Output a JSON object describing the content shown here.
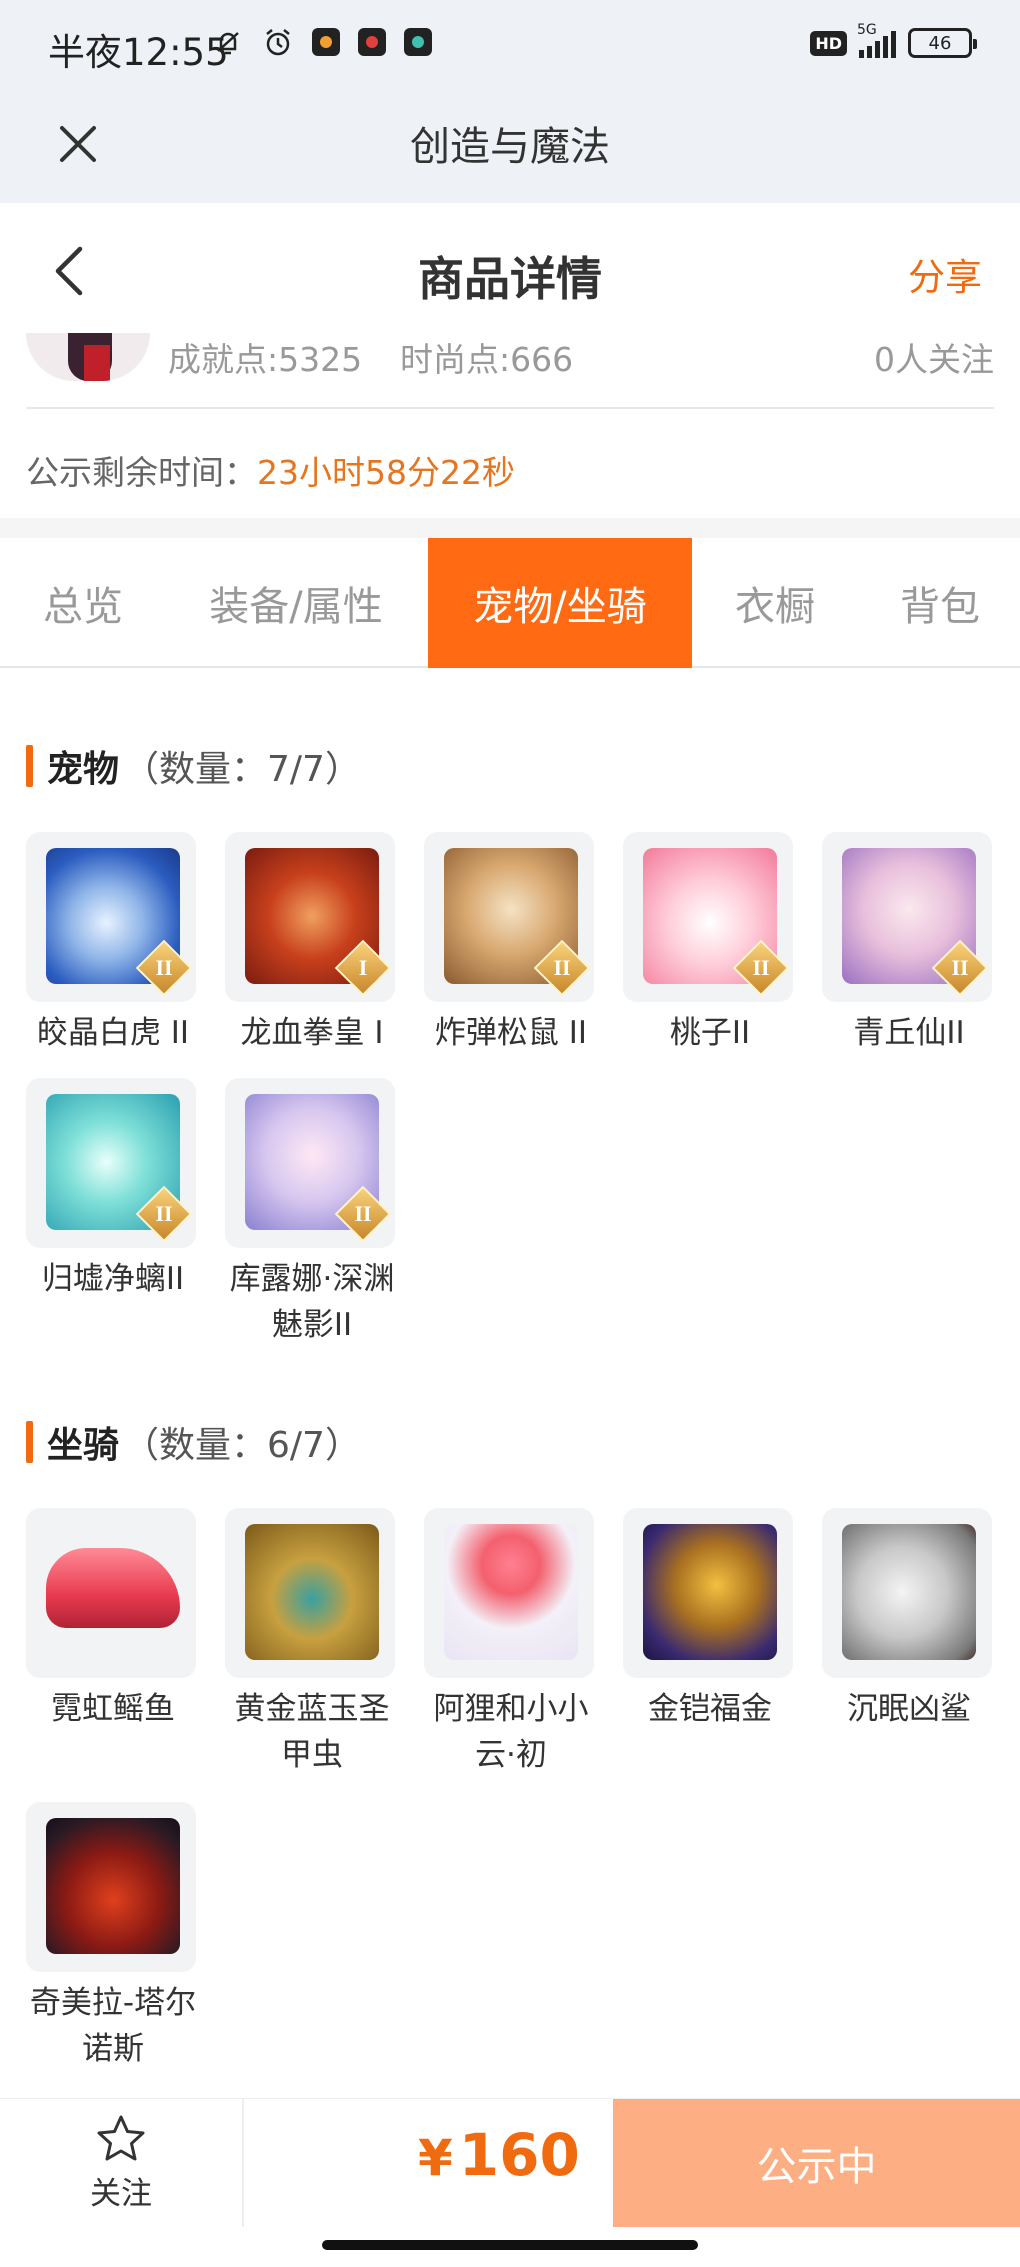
{
  "status_bar": {
    "time": "半夜12:55",
    "hd": "HD",
    "network": "5G",
    "battery": "46"
  },
  "app_header": {
    "title": "创造与魔法"
  },
  "page_nav": {
    "title": "商品详情",
    "share": "分享"
  },
  "user_info": {
    "achievement": "成就点:5325",
    "fashion": "时尚点:666",
    "followers": "0人关注"
  },
  "countdown": {
    "label": "公示剩余时间：",
    "value": "23小时58分22秒"
  },
  "tabs": [
    {
      "label": "总览"
    },
    {
      "label": "装备/属性"
    },
    {
      "label": "宠物/坐骑",
      "active": true
    },
    {
      "label": "衣橱"
    },
    {
      "label": "背包"
    }
  ],
  "pets": {
    "title": "宠物",
    "count": "（数量：7/7）",
    "items": [
      {
        "name": "皎晶白虎 II",
        "badge": "II",
        "icon": "white-tiger"
      },
      {
        "name": "龙血拳皇 I",
        "badge": "I",
        "icon": "dragon-boxer"
      },
      {
        "name": "炸弹松鼠 II",
        "badge": "II",
        "icon": "bomb-squirrel"
      },
      {
        "name": "桃子II",
        "badge": "II",
        "icon": "pink-fox"
      },
      {
        "name": "青丘仙II",
        "badge": "II",
        "icon": "fox-fairy"
      },
      {
        "name": "归墟净螭II",
        "badge": "II",
        "icon": "water-dragon"
      },
      {
        "name": "库露娜·深渊魅影II",
        "badge": "II",
        "icon": "abyss-phantom"
      }
    ]
  },
  "mounts": {
    "title": "坐骑",
    "count": "（数量：6/7）",
    "items": [
      {
        "name": "霓虹鳐鱼",
        "icon": "neon-ray"
      },
      {
        "name": "黄金蓝玉圣甲虫",
        "icon": "golden-scarab"
      },
      {
        "name": "阿狸和小小云·初",
        "icon": "ahri-cloud"
      },
      {
        "name": "金铠福金",
        "icon": "golden-armor"
      },
      {
        "name": "沉眠凶鲨",
        "icon": "shark"
      },
      {
        "name": "奇美拉-塔尔诺斯",
        "icon": "chimera"
      }
    ]
  },
  "bottom_bar": {
    "follow_label": "关注",
    "currency": "¥",
    "price": "160",
    "status": "公示中"
  },
  "colors": {
    "accent": "#ff6a13",
    "price": "#f06a10",
    "countdown": "#e5751e",
    "status_button": "#fdae82"
  }
}
